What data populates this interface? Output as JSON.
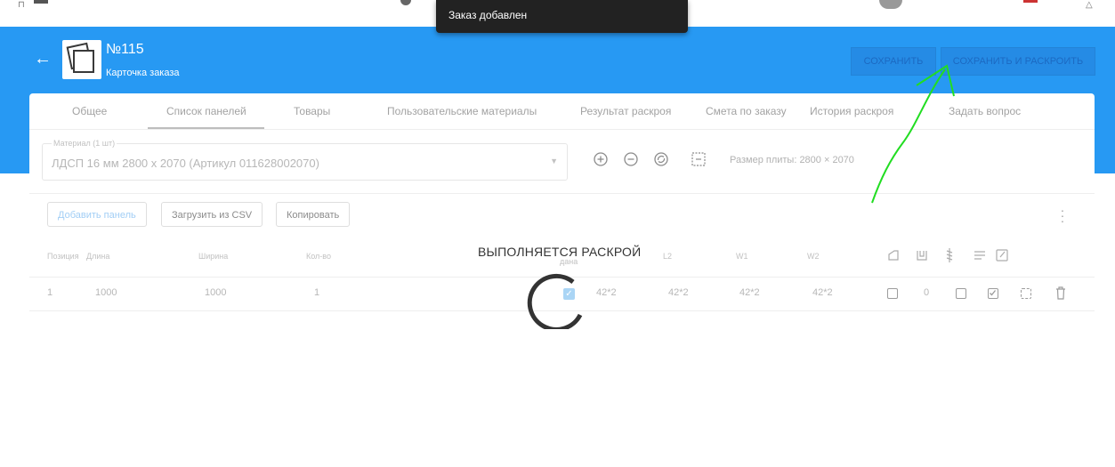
{
  "toast": {
    "text": "Заказ добавлен"
  },
  "header": {
    "order_number": "№115",
    "subtitle": "Карточка заказа",
    "save_label": "СОХРАНИТЬ",
    "save_cut_label": "СОХРАНИТЬ И РАСКРОИТЬ",
    "back_icon": "arrow-left-icon"
  },
  "tabs": [
    {
      "label": "Общее"
    },
    {
      "label": "Список панелей"
    },
    {
      "label": "Товары"
    },
    {
      "label": "Пользовательские материалы"
    },
    {
      "label": "Результат раскроя"
    },
    {
      "label": "Смета по заказу"
    },
    {
      "label": "История раскроя"
    },
    {
      "label": "Задать вопрос"
    }
  ],
  "material": {
    "label": "Материал (1 шт)",
    "value": "ЛДСП 16 мм 2800 x 2070 (Артикул 011628002070)"
  },
  "sheet_size": "Размер плиты: 2800 × 2070",
  "actions": {
    "add_panel": "Добавить панель",
    "upload_csv": "Загрузить из CSV",
    "copy": "Копировать"
  },
  "table": {
    "headers": {
      "position": "Позиция",
      "length": "Длина",
      "width": "Ширина",
      "qty": "Кол-во",
      "given": "дана",
      "l2": "L2",
      "w1": "W1",
      "w2": "W2"
    },
    "rows": [
      {
        "position": "1",
        "length": "1000",
        "width": "1000",
        "qty": "1",
        "l1": "42*2",
        "l2": "42*2",
        "w1": "42*2",
        "w2": "42*2",
        "count": "0"
      }
    ]
  },
  "loading": {
    "text": "ВЫПОЛНЯЕТСЯ РАСКРОЙ"
  },
  "colors": {
    "header_blue": "#2196f3",
    "toast_bg": "#222222",
    "annotation_arrow": "#22dd22"
  }
}
